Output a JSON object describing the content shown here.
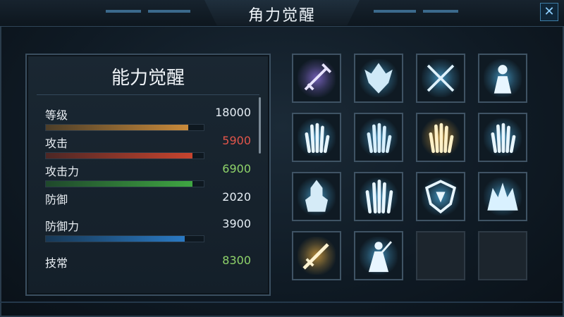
{
  "header": {
    "title": "角力觉醒",
    "close_glyph": "✕"
  },
  "stats_panel": {
    "title": "能力觉醒",
    "rows": [
      {
        "label": "等级",
        "value": "18000",
        "value_color": "#e6eef5",
        "fill": 0.9,
        "fill_color": "#c98a3a"
      },
      {
        "label": "攻击",
        "value": "5900",
        "value_color": "#e2554a",
        "fill": 0.93,
        "fill_color": "#c8442e"
      },
      {
        "label": "攻击力",
        "value": "6900",
        "value_color": "#8fd36a",
        "fill": 0.93,
        "fill_color": "#3fa642"
      },
      {
        "label": "防御",
        "value": "2020",
        "value_color": "#e6eef5",
        "fill": null,
        "fill_color": null
      },
      {
        "label": "防御力",
        "value": "3900",
        "value_color": "#e6eef5",
        "fill": 0.88,
        "fill_color": "#2a79c2"
      },
      {
        "label": "技常",
        "value": "8300",
        "value_color": "#8fd36a",
        "fill": null,
        "fill_color": null
      }
    ]
  },
  "skills": [
    {
      "icon": "sword-icon",
      "theme": "#8a6fd8",
      "empty": false
    },
    {
      "icon": "demon-head-icon",
      "theme": "#4aa6d6",
      "empty": false
    },
    {
      "icon": "crossed-swords-icon",
      "theme": "#4aa6d6",
      "empty": false
    },
    {
      "icon": "caster-silhouette-icon",
      "theme": "#4aa6d6",
      "empty": false
    },
    {
      "icon": "hand-icon",
      "theme": "#4aa6d6",
      "empty": false
    },
    {
      "icon": "spirit-hand-icon",
      "theme": "#4aa6d6",
      "empty": false
    },
    {
      "icon": "golden-hand-icon",
      "theme": "#d9a441",
      "empty": false
    },
    {
      "icon": "frost-hand-icon",
      "theme": "#4aa6d6",
      "empty": false
    },
    {
      "icon": "armored-warrior-icon",
      "theme": "#4aa6d6",
      "empty": false
    },
    {
      "icon": "glowing-hand-icon",
      "theme": "#4aa6d6",
      "empty": false
    },
    {
      "icon": "shield-crest-icon",
      "theme": "#4aa6d6",
      "empty": false
    },
    {
      "icon": "dark-crest-icon",
      "theme": "#4aa6d6",
      "empty": false
    },
    {
      "icon": "flaming-sword-icon",
      "theme": "#d9a441",
      "empty": false
    },
    {
      "icon": "mage-icon",
      "theme": "#4aa6d6",
      "empty": false
    },
    {
      "icon": "empty-slot",
      "theme": "#2e3a45",
      "empty": true
    },
    {
      "icon": "empty-slot",
      "theme": "#2e3a45",
      "empty": true
    }
  ]
}
